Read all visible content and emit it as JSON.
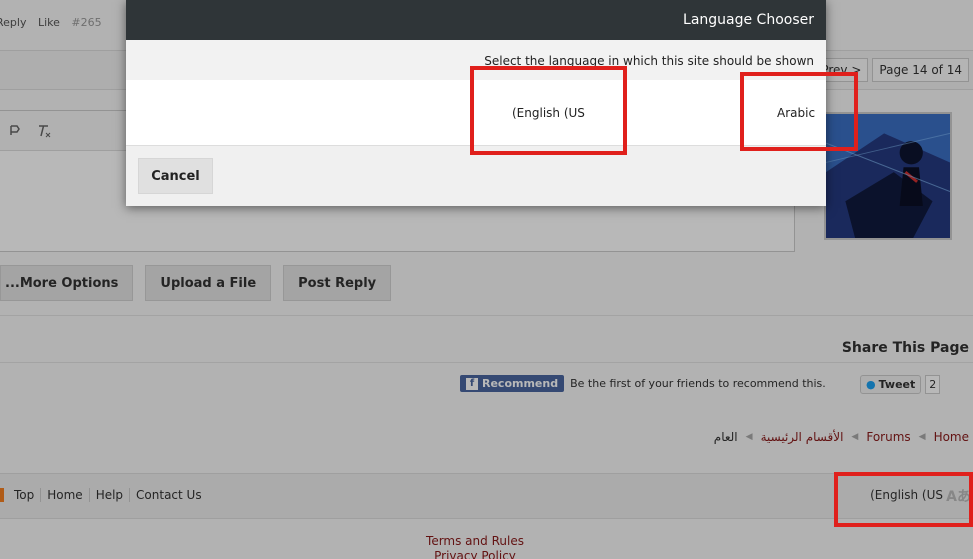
{
  "post": {
    "reply_label": "Reply",
    "like_label": "Like",
    "post_number": "#265"
  },
  "pager": {
    "prev_label": "Prev >",
    "page_info": "Page 14 of 14"
  },
  "editor": {
    "icons": [
      "spellcheck-icon",
      "clear-format-icon"
    ]
  },
  "actions": {
    "more_options": "...More Options",
    "upload_file": "Upload a File",
    "post_reply": "Post Reply"
  },
  "share": {
    "title": "Share This Page",
    "fb_label": "Recommend",
    "fb_text": "Be the first of your friends to recommend this.",
    "tweet_label": "Tweet",
    "tweet_count": "2"
  },
  "breadcrumb": {
    "items": [
      {
        "label": "Home"
      },
      {
        "label": "Forums"
      },
      {
        "label": "الأقسام الرئيسية"
      },
      {
        "label": "العام"
      }
    ]
  },
  "footer": {
    "links": [
      "Top",
      "Home",
      "Help",
      "Contact Us"
    ],
    "language": "(English (US",
    "terms": "Terms and Rules",
    "privacy": "Privacy Policy"
  },
  "modal": {
    "title": "Language Chooser",
    "description": "Select the language in which this site should be shown",
    "languages": [
      "(English (US",
      "Arabic"
    ],
    "cancel_label": "Cancel"
  },
  "colors": {
    "accent_red": "#e0201c",
    "modal_header": "#2f3538",
    "link_color": "#8a1a1a",
    "fb_blue": "#4a66a0"
  }
}
